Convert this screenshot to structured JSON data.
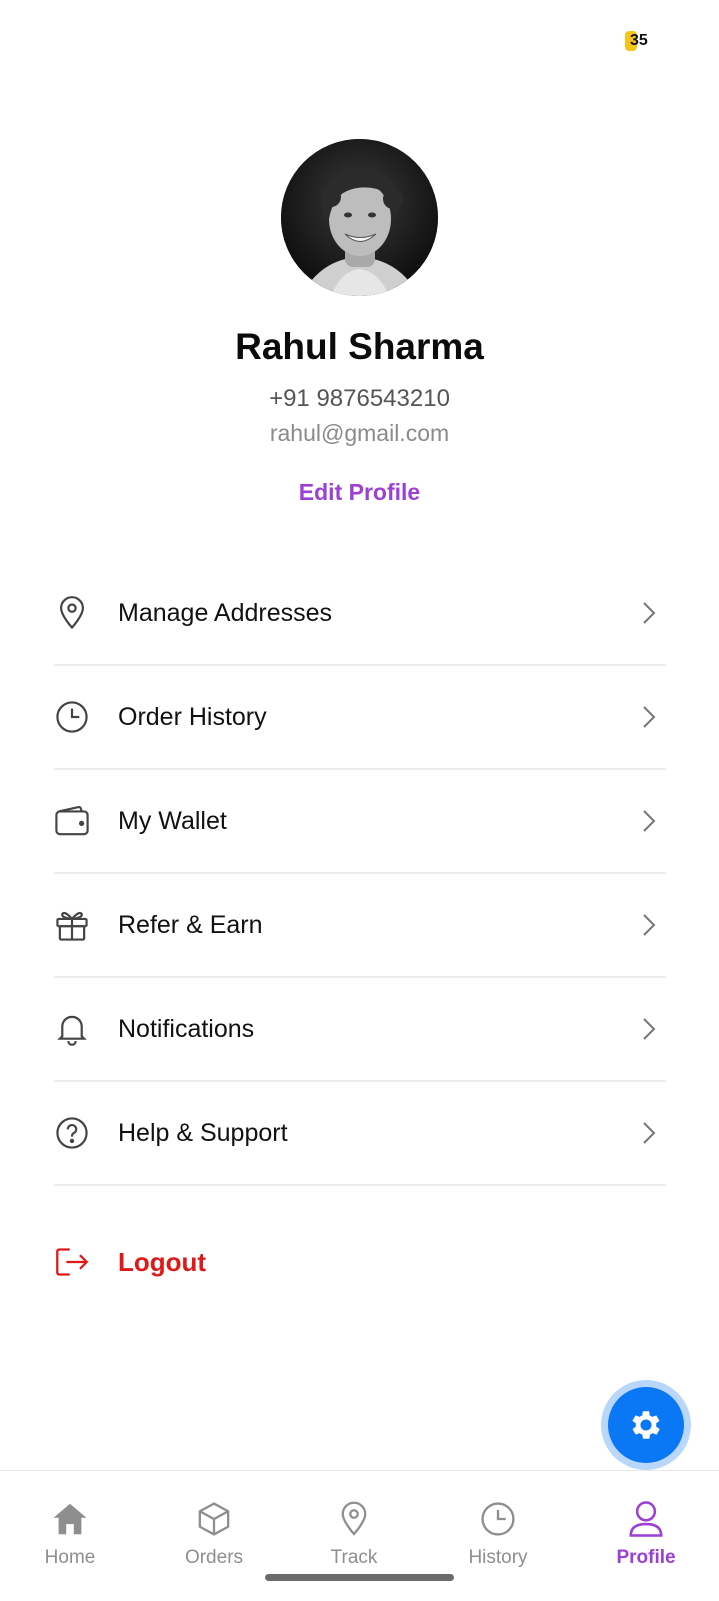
{
  "status": {
    "badge_count": "35",
    "badge_color": "#f5c518"
  },
  "profile": {
    "name": "Rahul Sharma",
    "phone": "+91 9876543210",
    "email": "rahul@gmail.com",
    "edit_label": "Edit Profile"
  },
  "menu": [
    {
      "label": "Manage Addresses",
      "icon": "location-pin-icon"
    },
    {
      "label": "Order History",
      "icon": "clock-icon"
    },
    {
      "label": "My Wallet",
      "icon": "wallet-icon"
    },
    {
      "label": "Refer & Earn",
      "icon": "gift-icon"
    },
    {
      "label": "Notifications",
      "icon": "bell-icon"
    },
    {
      "label": "Help & Support",
      "icon": "help-circle-icon"
    }
  ],
  "logout": {
    "label": "Logout",
    "icon": "logout-icon",
    "color": "#e01818"
  },
  "fab": {
    "icon": "gear-icon",
    "color": "#0a78f5"
  },
  "nav": {
    "items": [
      {
        "label": "Home",
        "icon": "home-icon"
      },
      {
        "label": "Orders",
        "icon": "box-icon"
      },
      {
        "label": "Track",
        "icon": "location-pin-icon"
      },
      {
        "label": "History",
        "icon": "clock-icon"
      },
      {
        "label": "Profile",
        "icon": "user-icon"
      }
    ],
    "active": "Profile"
  },
  "colors": {
    "accent": "#9b3fd6",
    "danger": "#e01818",
    "primary": "#0a78f5"
  }
}
